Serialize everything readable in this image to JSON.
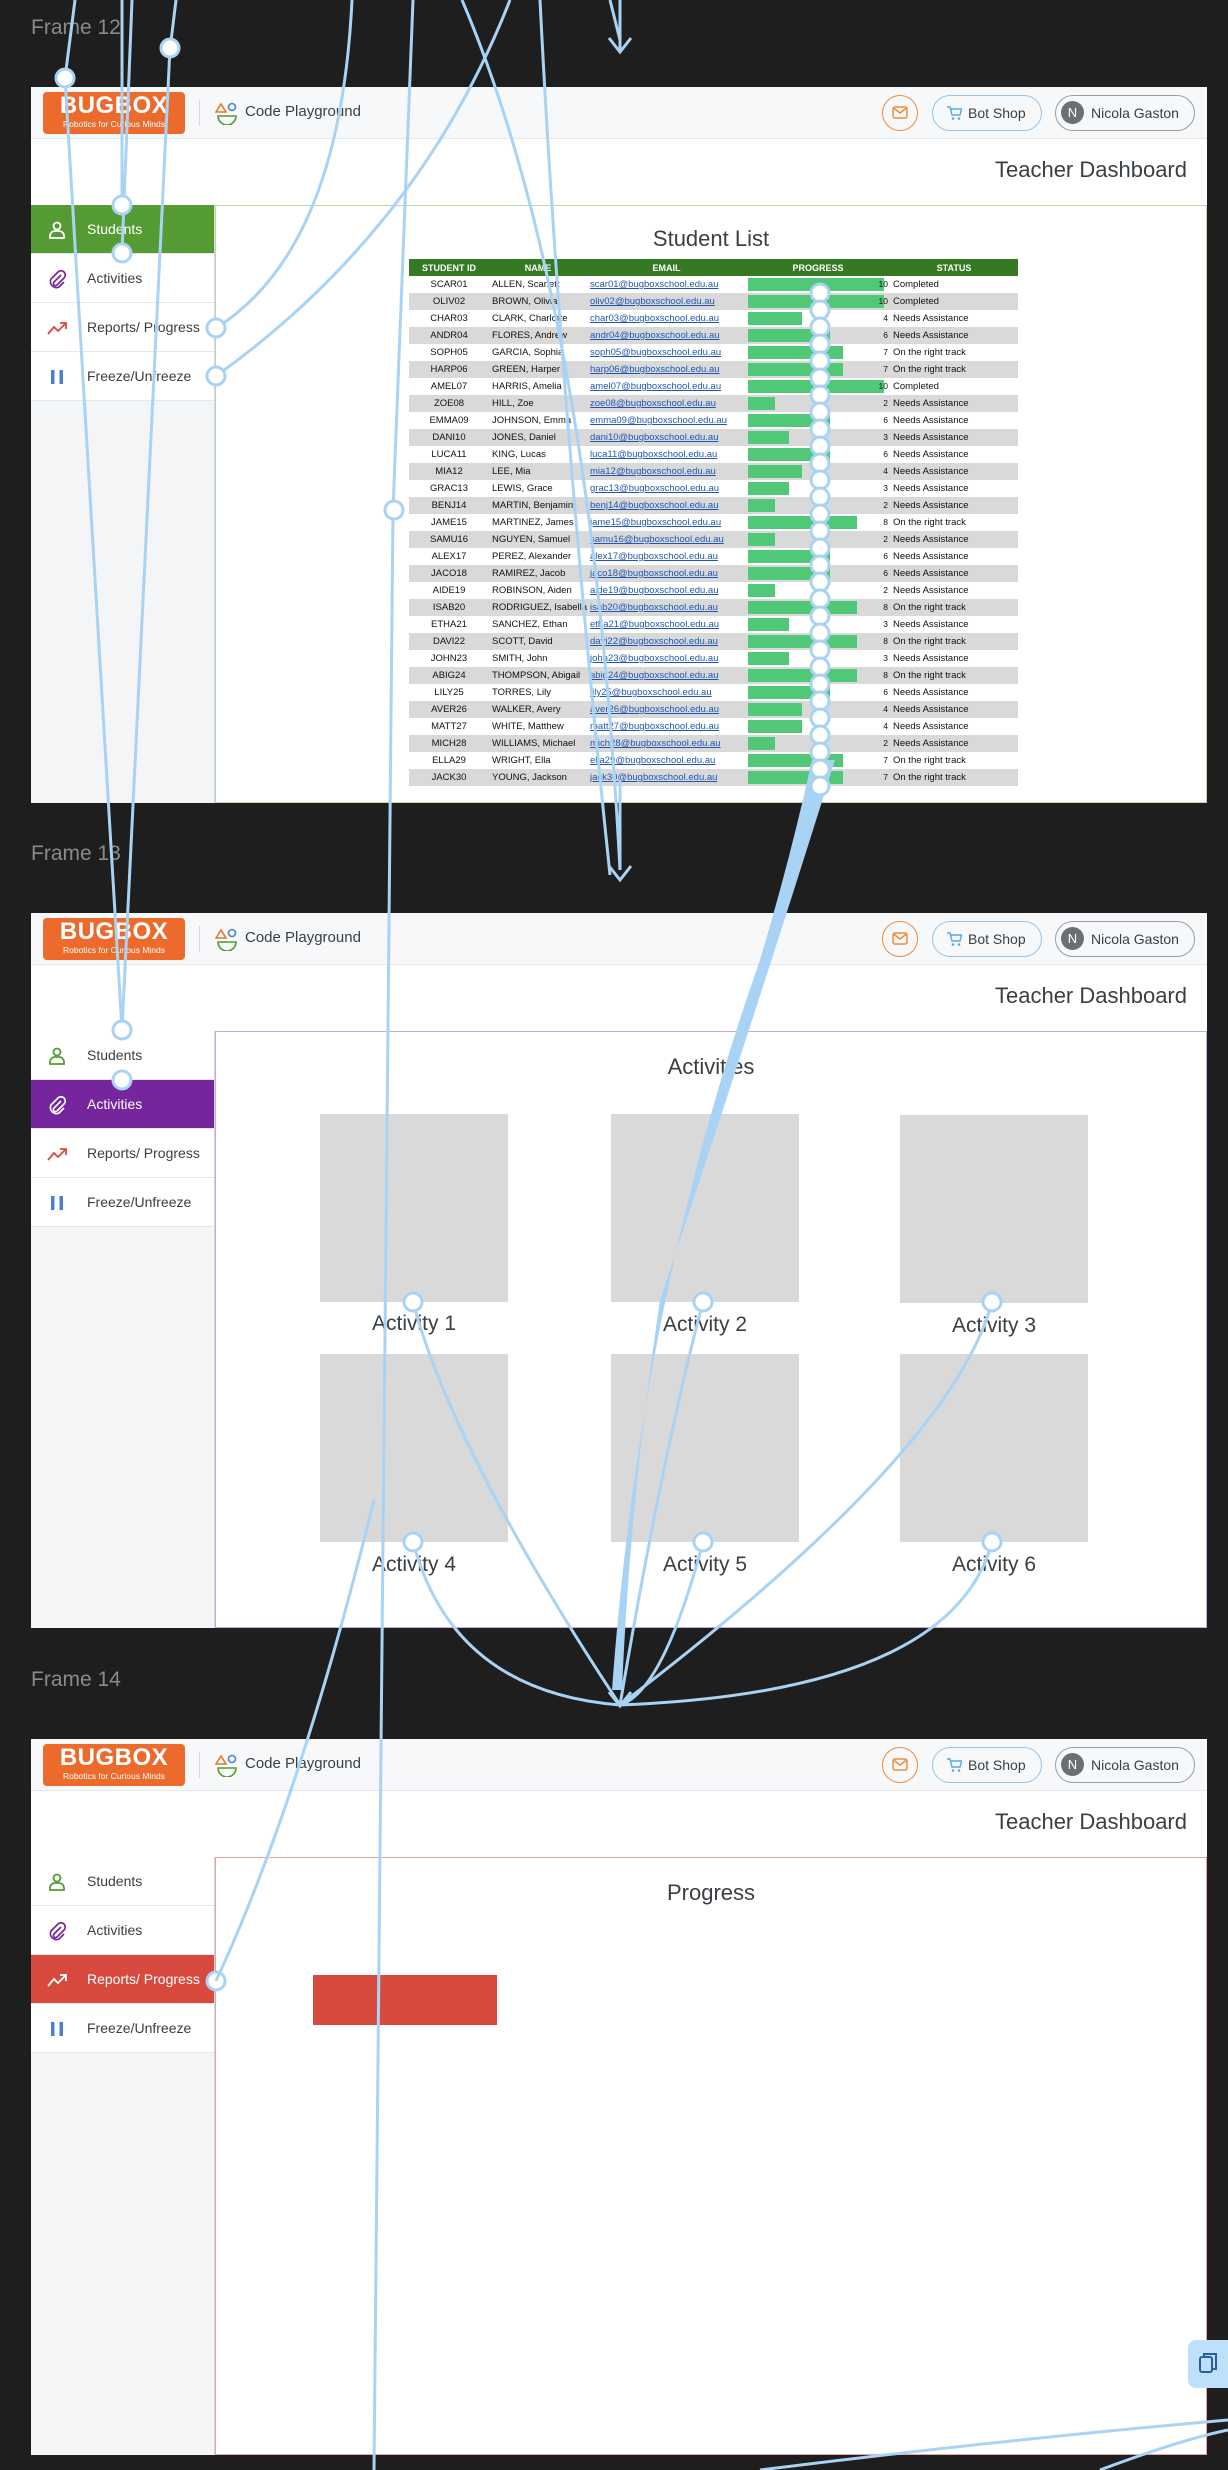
{
  "frames": [
    {
      "label": "Frame 12",
      "active_nav": 0,
      "view": "students"
    },
    {
      "label": "Frame 13",
      "active_nav": 1,
      "view": "activities"
    },
    {
      "label": "Frame 14",
      "active_nav": 2,
      "view": "progress"
    }
  ],
  "app": {
    "brand": "BUGBOX",
    "tagline": "Robotics for Curious Minds",
    "code_playground": "Code Playground",
    "bot_shop": "Bot Shop",
    "user_name": "Nicola Gaston",
    "user_initial": "N",
    "dashboard_title": "Teacher Dashboard"
  },
  "nav": [
    {
      "label": "Students",
      "icon": "person-icon"
    },
    {
      "label": "Activities",
      "icon": "paperclip-icon"
    },
    {
      "label": "Reports/ Progress",
      "icon": "trend-up-icon"
    },
    {
      "label": "Freeze/Unfreeze",
      "icon": "pause-icon"
    }
  ],
  "student_list": {
    "title": "Student List",
    "columns": [
      "STUDENT ID",
      "NAME",
      "EMAIL",
      "PROGRESS",
      "STATUS"
    ],
    "progress_max": 10,
    "rows": [
      {
        "id": "SCAR01",
        "name": "ALLEN, Scarlett",
        "email": "scar01@bugboxschool.edu.au",
        "progress": 10,
        "status": "Completed"
      },
      {
        "id": "OLIV02",
        "name": "BROWN, Olivia",
        "email": "oliv02@bugboxschool.edu.au",
        "progress": 10,
        "status": "Completed"
      },
      {
        "id": "CHAR03",
        "name": "CLARK, Charlotte",
        "email": "char03@bugboxschool.edu.au",
        "progress": 4,
        "status": "Needs Assistance"
      },
      {
        "id": "ANDR04",
        "name": "FLORES, Andrew",
        "email": "andr04@bugboxschool.edu.au",
        "progress": 6,
        "status": "Needs Assistance"
      },
      {
        "id": "SOPH05",
        "name": "GARCIA, Sophia",
        "email": "soph05@bugboxschool.edu.au",
        "progress": 7,
        "status": "On the right track"
      },
      {
        "id": "HARP06",
        "name": "GREEN, Harper",
        "email": "harp06@bugboxschool.edu.au",
        "progress": 7,
        "status": "On the right track"
      },
      {
        "id": "AMEL07",
        "name": "HARRIS, Amelia",
        "email": "amel07@bugboxschool.edu.au",
        "progress": 10,
        "status": "Completed"
      },
      {
        "id": "ZOE08",
        "name": "HILL, Zoe",
        "email": "zoe08@bugboxschool.edu.au",
        "progress": 2,
        "status": "Needs Assistance"
      },
      {
        "id": "EMMA09",
        "name": "JOHNSON, Emma",
        "email": "emma09@bugboxschool.edu.au",
        "progress": 6,
        "status": "Needs Assistance"
      },
      {
        "id": "DANI10",
        "name": "JONES, Daniel",
        "email": "dani10@bugboxschool.edu.au",
        "progress": 3,
        "status": "Needs Assistance"
      },
      {
        "id": "LUCA11",
        "name": "KING, Lucas",
        "email": "luca11@bugboxschool.edu.au",
        "progress": 6,
        "status": "Needs Assistance"
      },
      {
        "id": "MIA12",
        "name": "LEE, Mia",
        "email": "mia12@bugboxschool.edu.au",
        "progress": 4,
        "status": "Needs Assistance"
      },
      {
        "id": "GRAC13",
        "name": "LEWIS, Grace",
        "email": "grac13@bugboxschool.edu.au",
        "progress": 3,
        "status": "Needs Assistance"
      },
      {
        "id": "BENJ14",
        "name": "MARTIN, Benjamin",
        "email": "benj14@bugboxschool.edu.au",
        "progress": 2,
        "status": "Needs Assistance"
      },
      {
        "id": "JAME15",
        "name": "MARTINEZ, James",
        "email": "jame15@bugboxschool.edu.au",
        "progress": 8,
        "status": "On the right track"
      },
      {
        "id": "SAMU16",
        "name": "NGUYEN, Samuel",
        "email": "samu16@bugboxschool.edu.au",
        "progress": 2,
        "status": "Needs Assistance"
      },
      {
        "id": "ALEX17",
        "name": "PEREZ, Alexander",
        "email": "alex17@bugboxschool.edu.au",
        "progress": 6,
        "status": "Needs Assistance"
      },
      {
        "id": "JACO18",
        "name": "RAMIREZ, Jacob",
        "email": "jaco18@bugboxschool.edu.au",
        "progress": 6,
        "status": "Needs Assistance"
      },
      {
        "id": "AIDE19",
        "name": "ROBINSON, Aiden",
        "email": "aide19@bugboxschool.edu.au",
        "progress": 2,
        "status": "Needs Assistance"
      },
      {
        "id": "ISAB20",
        "name": "RODRIGUEZ, Isabella",
        "email": "isab20@bugboxschool.edu.au",
        "progress": 8,
        "status": "On the right track"
      },
      {
        "id": "ETHA21",
        "name": "SANCHEZ, Ethan",
        "email": "etha21@bugboxschool.edu.au",
        "progress": 3,
        "status": "Needs Assistance"
      },
      {
        "id": "DAVI22",
        "name": "SCOTT, David",
        "email": "davi22@bugboxschool.edu.au",
        "progress": 8,
        "status": "On the right track"
      },
      {
        "id": "JOHN23",
        "name": "SMITH, John",
        "email": "john23@bugboxschool.edu.au",
        "progress": 3,
        "status": "Needs Assistance"
      },
      {
        "id": "ABIG24",
        "name": "THOMPSON, Abigail",
        "email": "abig24@bugboxschool.edu.au",
        "progress": 8,
        "status": "On the right track"
      },
      {
        "id": "LILY25",
        "name": "TORRES, Lily",
        "email": "lily25@bugboxschool.edu.au",
        "progress": 6,
        "status": "Needs Assistance"
      },
      {
        "id": "AVER26",
        "name": "WALKER, Avery",
        "email": "aver26@bugboxschool.edu.au",
        "progress": 4,
        "status": "Needs Assistance"
      },
      {
        "id": "MATT27",
        "name": "WHITE, Matthew",
        "email": "matt27@bugboxschool.edu.au",
        "progress": 4,
        "status": "Needs Assistance"
      },
      {
        "id": "MICH28",
        "name": "WILLIAMS, Michael",
        "email": "mich28@bugboxschool.edu.au",
        "progress": 2,
        "status": "Needs Assistance"
      },
      {
        "id": "ELLA29",
        "name": "WRIGHT, Ella",
        "email": "ella29@bugboxschool.edu.au",
        "progress": 7,
        "status": "On the right track"
      },
      {
        "id": "JACK30",
        "name": "YOUNG, Jackson",
        "email": "jack30@bugboxschool.edu.au",
        "progress": 7,
        "status": "On the right track"
      }
    ]
  },
  "activities": {
    "title": "Activities",
    "items": [
      "Activity 1",
      "Activity 2",
      "Activity 3",
      "Activity 4",
      "Activity 5",
      "Activity 6"
    ]
  },
  "progress_view": {
    "title": "Progress"
  },
  "colors": {
    "brand_orange": "#ec6a2c",
    "students_green": "#559b33",
    "activities_purple": "#76269c",
    "progress_red": "#d94a3e",
    "freeze_blue": "#4a7fd4",
    "wire_blue": "#a9d3f5",
    "progress_bar": "#50c878"
  }
}
